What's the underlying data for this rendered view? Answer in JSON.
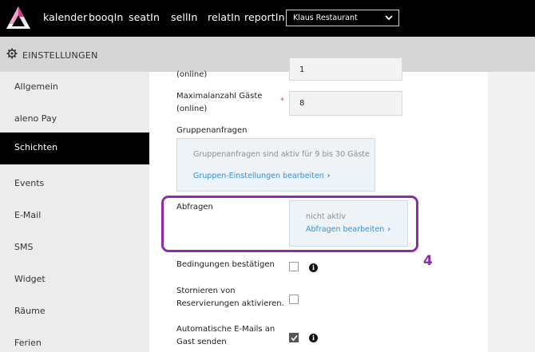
{
  "topbar": {
    "nav": [
      "kalender",
      "booqIn",
      "seatIn",
      "sellIn",
      "relatIn",
      "reportIn"
    ],
    "restaurant": "Klaus Restaurant"
  },
  "settings": {
    "title": "EINSTELLUNGEN"
  },
  "sidebar": {
    "items": [
      "Allgemein",
      "aleno Pay",
      "Schichten",
      "Events",
      "E-Mail",
      "SMS",
      "Widget",
      "Räume",
      "Ferien"
    ],
    "active": "Schichten"
  },
  "form": {
    "online_label": "(online)",
    "online_value": "1",
    "max_guests_label_line1": "Maximalanzahl Gäste",
    "max_guests_label_line2": "(online)",
    "required_mark": "*",
    "max_guests_value": "8",
    "group_label": "Gruppenanfragen",
    "group_text": "Gruppenanfragen sind aktiv für 9 bis 30 Gäste",
    "group_link": "Gruppen-Einstellungen bearbeiten",
    "abfragen_label": "Abfragen",
    "abfragen_status": "nicht aktiv",
    "abfragen_link": "Abfragen bearbeiten",
    "conditions_label": "Bedingungen bestätigen",
    "cancel_label_line1": "Stornieren von",
    "cancel_label_line2": "Reservierungen aktivieren.",
    "auto_email_label_line1": "Automatische E-Mails an",
    "auto_email_label_line2": "Gast senden",
    "conditions_checked": false,
    "cancel_checked": false,
    "auto_email_checked": true,
    "info_glyph": "i"
  },
  "annotation": {
    "step_number": "4",
    "color": "#8e2ca8"
  },
  "colors": {
    "topbar": "#000000",
    "link": "#3a8fd6",
    "active_sidebar": "#000000"
  }
}
